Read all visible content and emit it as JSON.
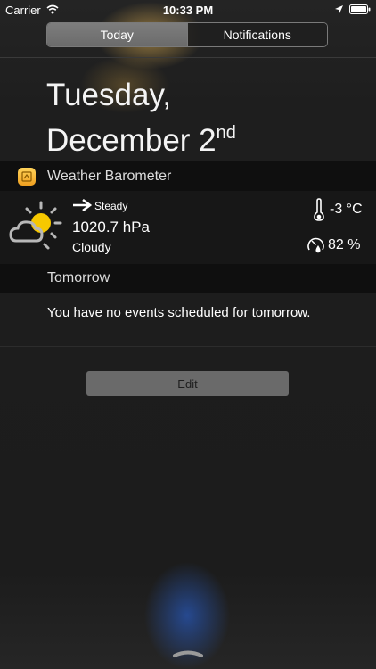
{
  "status_bar": {
    "carrier": "Carrier",
    "time": "10:33 PM",
    "icons": [
      "wifi-icon",
      "location-icon",
      "battery-icon"
    ]
  },
  "tabs": [
    {
      "label": "Today",
      "selected": true
    },
    {
      "label": "Notifications",
      "selected": false
    }
  ],
  "date": {
    "line1": "Tuesday,",
    "line2_prefix": "December 2",
    "line2_suffix": "nd"
  },
  "weather_widget": {
    "title": "Weather Barometer",
    "trend": "Steady",
    "pressure": "1020.7 hPa",
    "condition": "Cloudy",
    "temperature": "-3 °C",
    "humidity": "82 %",
    "icons": [
      "app-icon",
      "partly-cloudy-icon",
      "arrow-right-icon",
      "thermometer-icon",
      "humidity-gauge-icon"
    ]
  },
  "tomorrow": {
    "title": "Tomorrow",
    "message": "You have no events scheduled for tomorrow."
  },
  "edit_button": {
    "label": "Edit"
  },
  "colors": {
    "section_header_bg": "#0f0f0f",
    "sun": "#f7c800",
    "active_tab": "#757575"
  }
}
